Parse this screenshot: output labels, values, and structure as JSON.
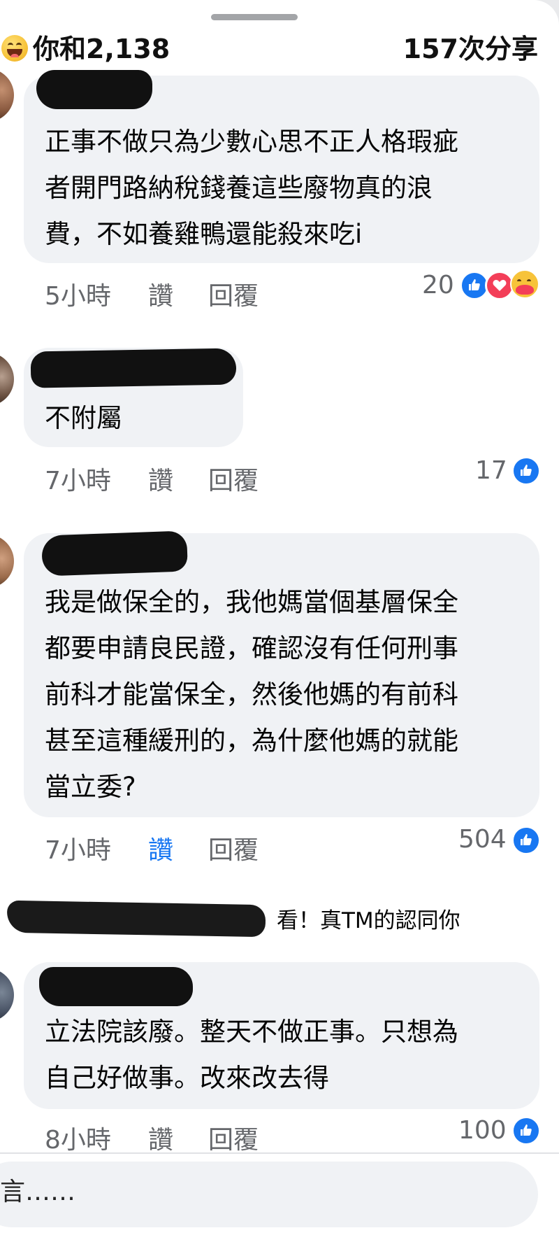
{
  "header": {
    "reactors_text": "你和2,138",
    "shares_text": "157次分享",
    "reaction_icon": "haha-icon"
  },
  "comments": [
    {
      "text": "正事不做只為少數心思不正人格瑕疵\n者￼開門路納稅錢養這些廢物真的浪\n費，不如養雞鴨還能殺來吃i",
      "time": "5小時",
      "like_label": "讚",
      "reply_label": "回覆",
      "reaction_count": "20",
      "reactions": [
        "like-icon",
        "love-icon",
        "care-icon"
      ],
      "liked": false
    },
    {
      "text": "不附屬",
      "time": "7小時",
      "like_label": "讚",
      "reply_label": "回覆",
      "reaction_count": "17",
      "reactions": [
        "like-icon"
      ],
      "liked": false
    },
    {
      "text": "我是做保全的，我他媽當個基層保全\n都要申請良民證，確認沒有任何刑事\n前科才能當保全，然後他媽的有前科\n甚至這種緩刑的，為什麼他媽的就能\n當立委?",
      "time": "7小時",
      "like_label": "讚",
      "reply_label": "回覆",
      "reaction_count": "504",
      "reactions": [
        "like-icon"
      ],
      "liked": true,
      "reply_preview": "看！真TM的認同你"
    },
    {
      "text": "立法院該廢。整天不做正事。只想為\n自己好做事。改來改去得",
      "time": "8小時",
      "like_label": "讚",
      "reply_label": "回覆",
      "reaction_count": "100",
      "reactions": [
        "like-icon"
      ],
      "liked": false
    }
  ],
  "composer": {
    "placeholder": "言……"
  },
  "colors": {
    "accent": "#1877f2",
    "bubble": "#f0f2f5",
    "meta_text": "#65676b"
  }
}
